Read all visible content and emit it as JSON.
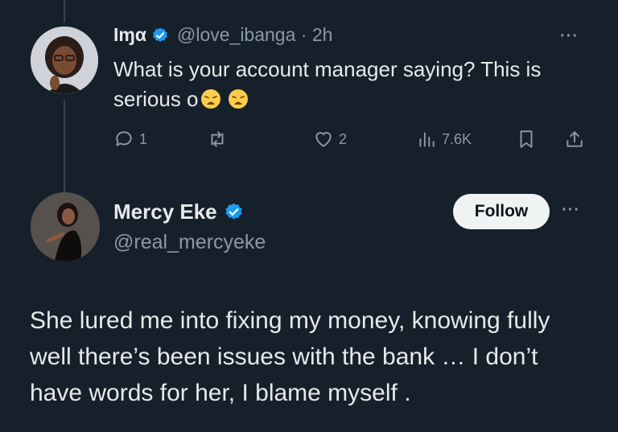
{
  "reply": {
    "display_name": "Iɱα",
    "handle": "@love_ibanga",
    "separator": "·",
    "time": "2h",
    "text": "What is your account manager saying? This is serious o",
    "reply_count": "1",
    "like_count": "2",
    "view_count": "7.6K",
    "more_label": "···"
  },
  "main": {
    "display_name": "Mercy Eke",
    "handle": "@real_mercyeke",
    "follow_label": "Follow",
    "more_label": "···",
    "text": "She lured me into fixing my money, knowing fully well there’s been issues with the bank … I don’t have words for her, I blame myself ."
  },
  "colors": {
    "background": "#15202b",
    "verified": "#1d9bf0",
    "muted": "#8b98a5",
    "text": "#e7e9ea"
  }
}
